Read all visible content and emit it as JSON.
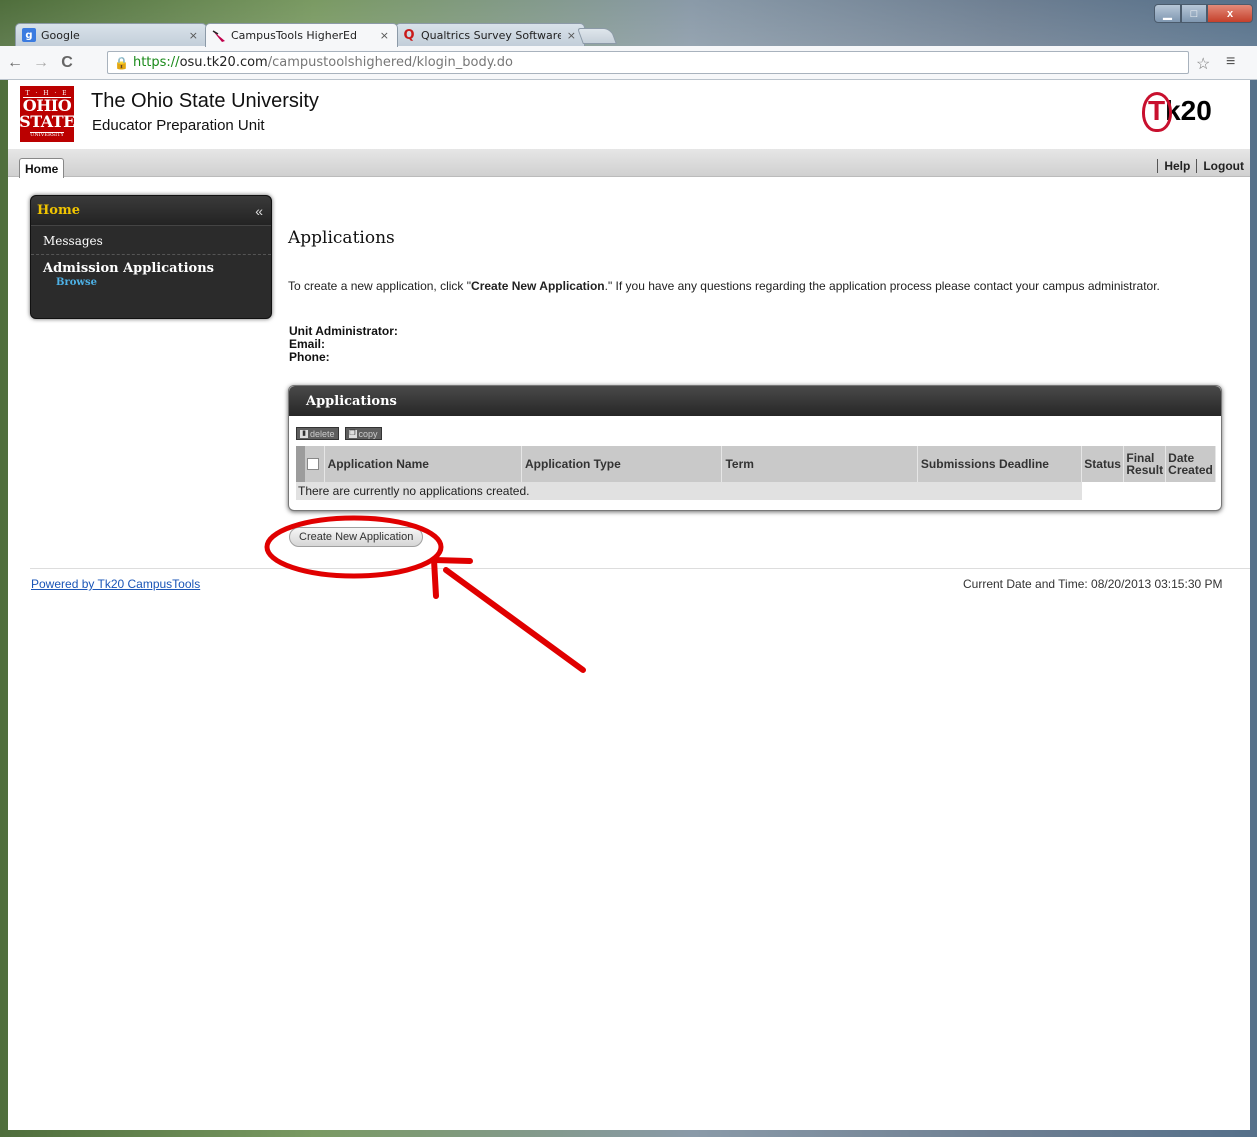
{
  "browser": {
    "tabs": [
      {
        "title": "Google",
        "favicon": "google-icon",
        "color": "#3b7be0",
        "glyph": "g"
      },
      {
        "title": "CampusTools HigherEd",
        "favicon": "feather-icon",
        "color": "#c0004b",
        "glyph": ""
      },
      {
        "title": "Qualtrics Survey Software",
        "favicon": "qualtrics-icon",
        "color": "#c91a1a",
        "glyph": "Q"
      }
    ],
    "tab_close": "×",
    "url_scheme": "https://",
    "url_host": "osu.tk20.com",
    "url_path": "/campustoolshighered/klogin_body.do",
    "win_min": "▁",
    "win_max": "□",
    "win_close": "x"
  },
  "header": {
    "logo": {
      "line1": "T · H · E",
      "line2": "OHIO",
      "line3": "STATE",
      "line4": "UNIVERSITY"
    },
    "institution": "The Ohio State University",
    "unit": "Educator Preparation Unit",
    "brand": "Tk20",
    "brand_t": "T",
    "brand_rest": "k20"
  },
  "nav": {
    "home_tab": "Home",
    "help": "Help",
    "logout": "Logout"
  },
  "sidebar": {
    "title": "Home",
    "collapse_icon": "«",
    "messages": "Messages",
    "group_title": "Admission Applications",
    "browse": "Browse"
  },
  "main": {
    "title": "Applications",
    "intro_pre": "To create a new application, click \"",
    "intro_bold": "Create New Application",
    "intro_post": ".\" If you have any questions regarding the application process please contact your campus administrator.",
    "contact_admin": "Unit Administrator:",
    "contact_email": "Email:",
    "contact_phone": "Phone:"
  },
  "apps_panel": {
    "title": "Applications",
    "delete_label": "delete",
    "copy_label": "copy",
    "columns": [
      "Application Name",
      "Application Type",
      "Term",
      "Submissions Deadline",
      "Status",
      "Final Result",
      "Date Created"
    ],
    "empty_text": "There are currently no applications created."
  },
  "create_button": "Create New Application",
  "footer": {
    "powered": "Powered by Tk20 CampusTools",
    "datetime": "Current Date and Time: 08/20/2013 03:15:30 PM"
  },
  "colors": {
    "osu_red": "#bb0000",
    "tk20_red": "#c8102e",
    "annotation_red": "#e00000",
    "sidebar_accent": "#f0c400",
    "link_blue": "#1a55b7"
  }
}
